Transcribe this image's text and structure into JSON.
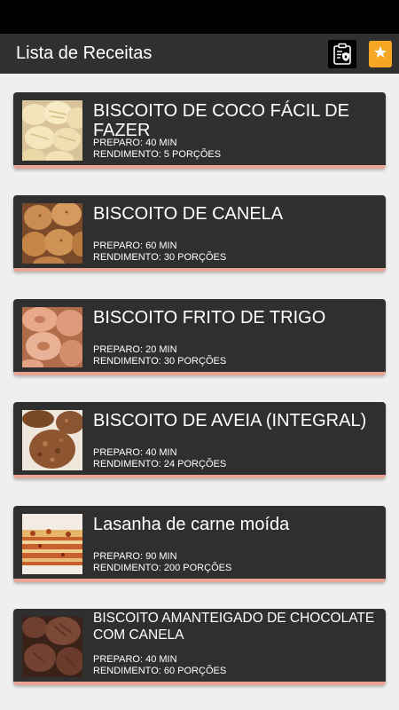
{
  "app_title": "Lista de Receitas",
  "toolbar": {
    "policy_icon": "privacy-policy-icon",
    "favorites_icon": "bookmark-star-icon",
    "accent": "#f5a623"
  },
  "recipes": [
    {
      "name": "BISCOITO DE COCO FÁCIL DE FAZER",
      "prep_label": "PREPARO:",
      "prep_value": "40 MIN",
      "yield_label": "RENDIMENTO:",
      "yield_value": "5 PORÇÕES",
      "image": "coconut-cookies-photo"
    },
    {
      "name": "BISCOITO DE CANELA",
      "prep_label": "PREPARO:",
      "prep_value": "60 MIN",
      "yield_label": "RENDIMENTO:",
      "yield_value": "30 PORÇÕES",
      "image": "cinnamon-cookies-photo"
    },
    {
      "name": "BISCOITO FRITO DE TRIGO",
      "prep_label": "PREPARO:",
      "prep_value": "20 MIN",
      "yield_label": "RENDIMENTO:",
      "yield_value": "30 PORÇÕES",
      "image": "fried-biscuits-photo"
    },
    {
      "name": "BISCOITO DE AVEIA (INTEGRAL)",
      "prep_label": "PREPARO:",
      "prep_value": "40 MIN",
      "yield_label": "RENDIMENTO:",
      "yield_value": "24 PORÇÕES",
      "image": "oat-cookies-photo"
    },
    {
      "name": "Lasanha de carne moída",
      "prep_label": "PREPARO:",
      "prep_value": "90 MIN",
      "yield_label": "RENDIMENTO:",
      "yield_value": "200 PORÇÕES",
      "image": "lasagna-photo"
    },
    {
      "name": "BISCOITO AMANTEIGADO DE CHOCOLATE COM CANELA",
      "prep_label": "PREPARO:",
      "prep_value": "40 MIN",
      "yield_label": "RENDIMENTO:",
      "yield_value": "60 PORÇÕES",
      "image": "chocolate-cookies-photo"
    }
  ]
}
